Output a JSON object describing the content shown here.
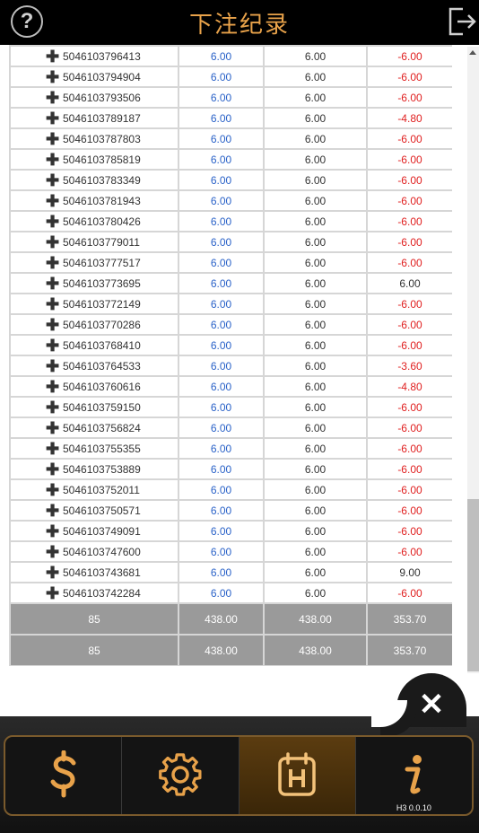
{
  "header": {
    "title": "下注纪录",
    "help_label": "?"
  },
  "rows": [
    {
      "id": "5046103796413",
      "bet": "6.00",
      "valid": "6.00",
      "result": "-6.00"
    },
    {
      "id": "5046103794904",
      "bet": "6.00",
      "valid": "6.00",
      "result": "-6.00"
    },
    {
      "id": "5046103793506",
      "bet": "6.00",
      "valid": "6.00",
      "result": "-6.00"
    },
    {
      "id": "5046103789187",
      "bet": "6.00",
      "valid": "6.00",
      "result": "-4.80"
    },
    {
      "id": "5046103787803",
      "bet": "6.00",
      "valid": "6.00",
      "result": "-6.00"
    },
    {
      "id": "5046103785819",
      "bet": "6.00",
      "valid": "6.00",
      "result": "-6.00"
    },
    {
      "id": "5046103783349",
      "bet": "6.00",
      "valid": "6.00",
      "result": "-6.00"
    },
    {
      "id": "5046103781943",
      "bet": "6.00",
      "valid": "6.00",
      "result": "-6.00"
    },
    {
      "id": "5046103780426",
      "bet": "6.00",
      "valid": "6.00",
      "result": "-6.00"
    },
    {
      "id": "5046103779011",
      "bet": "6.00",
      "valid": "6.00",
      "result": "-6.00"
    },
    {
      "id": "5046103777517",
      "bet": "6.00",
      "valid": "6.00",
      "result": "-6.00"
    },
    {
      "id": "5046103773695",
      "bet": "6.00",
      "valid": "6.00",
      "result": "6.00"
    },
    {
      "id": "5046103772149",
      "bet": "6.00",
      "valid": "6.00",
      "result": "-6.00"
    },
    {
      "id": "5046103770286",
      "bet": "6.00",
      "valid": "6.00",
      "result": "-6.00"
    },
    {
      "id": "5046103768410",
      "bet": "6.00",
      "valid": "6.00",
      "result": "-6.00"
    },
    {
      "id": "5046103764533",
      "bet": "6.00",
      "valid": "6.00",
      "result": "-3.60"
    },
    {
      "id": "5046103760616",
      "bet": "6.00",
      "valid": "6.00",
      "result": "-4.80"
    },
    {
      "id": "5046103759150",
      "bet": "6.00",
      "valid": "6.00",
      "result": "-6.00"
    },
    {
      "id": "5046103756824",
      "bet": "6.00",
      "valid": "6.00",
      "result": "-6.00"
    },
    {
      "id": "5046103755355",
      "bet": "6.00",
      "valid": "6.00",
      "result": "-6.00"
    },
    {
      "id": "5046103753889",
      "bet": "6.00",
      "valid": "6.00",
      "result": "-6.00"
    },
    {
      "id": "5046103752011",
      "bet": "6.00",
      "valid": "6.00",
      "result": "-6.00"
    },
    {
      "id": "5046103750571",
      "bet": "6.00",
      "valid": "6.00",
      "result": "-6.00"
    },
    {
      "id": "5046103749091",
      "bet": "6.00",
      "valid": "6.00",
      "result": "-6.00"
    },
    {
      "id": "5046103747600",
      "bet": "6.00",
      "valid": "6.00",
      "result": "-6.00"
    },
    {
      "id": "5046103743681",
      "bet": "6.00",
      "valid": "6.00",
      "result": "9.00"
    },
    {
      "id": "5046103742284",
      "bet": "6.00",
      "valid": "6.00",
      "result": "-6.00"
    }
  ],
  "totals": [
    {
      "count": "85",
      "bet": "438.00",
      "valid": "438.00",
      "result": "353.70"
    },
    {
      "count": "85",
      "bet": "438.00",
      "valid": "438.00",
      "result": "353.70"
    }
  ],
  "nav": {
    "items": [
      {
        "icon": "dollar-icon",
        "active": false
      },
      {
        "icon": "gear-icon",
        "active": false
      },
      {
        "icon": "history-icon",
        "active": true
      },
      {
        "icon": "info-icon",
        "active": false
      }
    ],
    "version": "H3 0.0.10",
    "close_label": "✕"
  },
  "colors": {
    "title": "#e8a24a",
    "bet_value": "#2a62c8",
    "loss": "#e02020",
    "gold": "#e8a24a",
    "total_row_bg": "#9a9a9a"
  }
}
